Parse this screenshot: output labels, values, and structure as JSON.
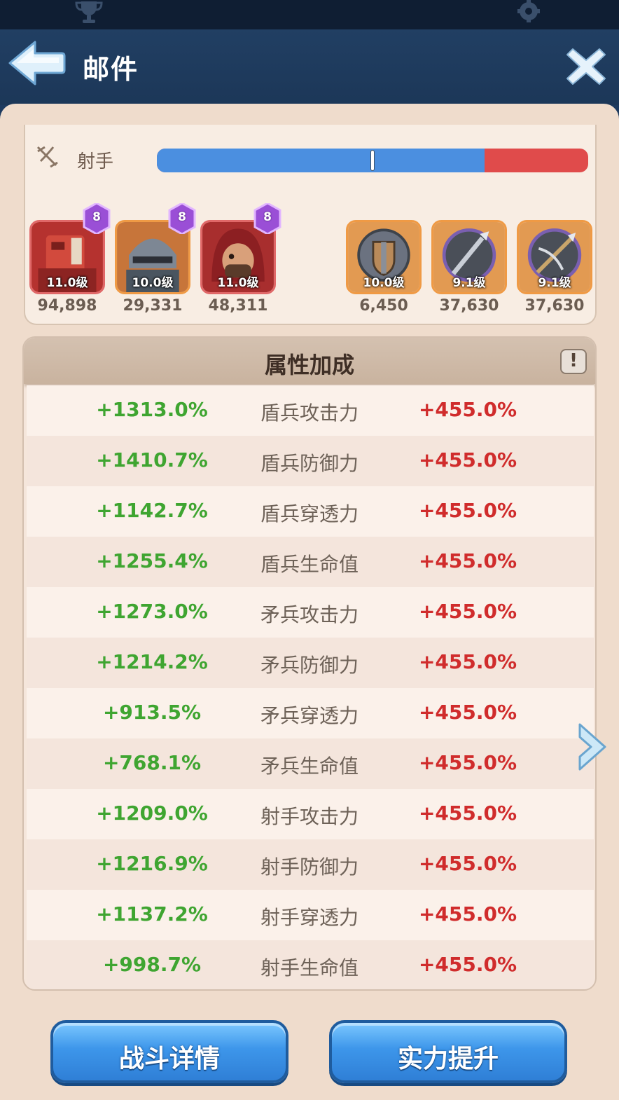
{
  "header": {
    "title": "邮件"
  },
  "class_row": {
    "label": "射手",
    "bar_blue_fraction": 0.76,
    "marker_fraction": 0.5
  },
  "left_units": [
    {
      "level": "11.0级",
      "star": "8",
      "value": "94,898",
      "icon": "red-armored-soldier-portrait"
    },
    {
      "level": "10.0级",
      "star": "8",
      "value": "29,331",
      "icon": "helmet-knight-portrait"
    },
    {
      "level": "11.0级",
      "star": "8",
      "value": "48,311",
      "icon": "hooded-archer-portrait"
    }
  ],
  "right_units": [
    {
      "level": "10.0级",
      "value": "6,450",
      "icon": "shield-emblem"
    },
    {
      "level": "9.1级",
      "value": "37,630",
      "icon": "spear-emblem"
    },
    {
      "level": "9.1级",
      "value": "37,630",
      "icon": "crossbow-emblem"
    }
  ],
  "stats": {
    "title": "属性加成",
    "info_symbol": "!",
    "rows": [
      {
        "left": "+1313.0%",
        "name": "盾兵攻击力",
        "right": "+455.0%"
      },
      {
        "left": "+1410.7%",
        "name": "盾兵防御力",
        "right": "+455.0%"
      },
      {
        "left": "+1142.7%",
        "name": "盾兵穿透力",
        "right": "+455.0%"
      },
      {
        "left": "+1255.4%",
        "name": "盾兵生命值",
        "right": "+455.0%"
      },
      {
        "left": "+1273.0%",
        "name": "矛兵攻击力",
        "right": "+455.0%"
      },
      {
        "left": "+1214.2%",
        "name": "矛兵防御力",
        "right": "+455.0%"
      },
      {
        "left": "+913.5%",
        "name": "矛兵穿透力",
        "right": "+455.0%"
      },
      {
        "left": "+768.1%",
        "name": "矛兵生命值",
        "right": "+455.0%"
      },
      {
        "left": "+1209.0%",
        "name": "射手攻击力",
        "right": "+455.0%"
      },
      {
        "left": "+1216.9%",
        "name": "射手防御力",
        "right": "+455.0%"
      },
      {
        "left": "+1137.2%",
        "name": "射手穿透力",
        "right": "+455.0%"
      },
      {
        "left": "+998.7%",
        "name": "射手生命值",
        "right": "+455.0%"
      }
    ]
  },
  "buttons": {
    "battle_details": "战斗详情",
    "power_up": "实力提升"
  },
  "colors": {
    "bonus_green": "#3fa531",
    "bonus_red": "#d02c2c",
    "bar_blue": "#4b8fe0",
    "bar_red": "#e04b4b"
  }
}
